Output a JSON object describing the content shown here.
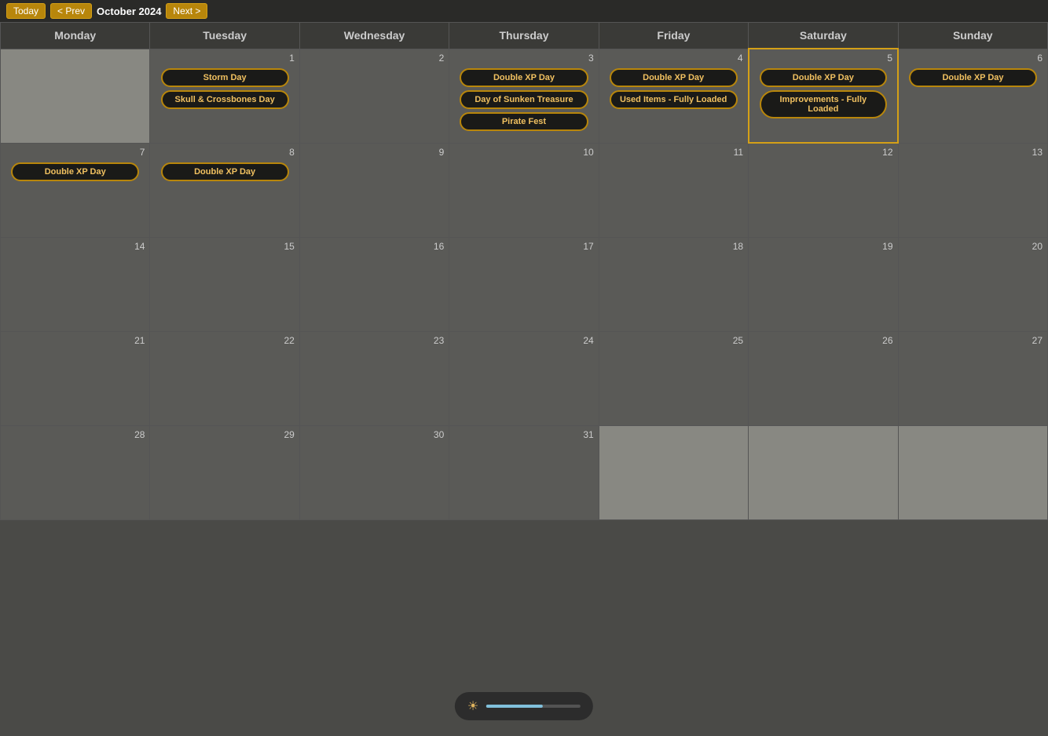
{
  "topbar": {
    "today_label": "Today",
    "prev_label": "< Prev",
    "month_label": "October 2024",
    "next_label": "Next >"
  },
  "headers": [
    "Monday",
    "Tuesday",
    "Wednesday",
    "Thursday",
    "Friday",
    "Saturday",
    "Sunday"
  ],
  "weeks": [
    {
      "days": [
        {
          "number": "",
          "events": [],
          "grayed": true
        },
        {
          "number": "1",
          "events": [
            "Storm Day",
            "Skull & Crossbones Day"
          ],
          "grayed": false
        },
        {
          "number": "2",
          "events": [],
          "grayed": false
        },
        {
          "number": "3",
          "events": [
            "Double XP Day",
            "Day of Sunken Treasure",
            "Pirate Fest"
          ],
          "grayed": false
        },
        {
          "number": "4",
          "events": [
            "Double XP Day",
            "Used Items - Fully Loaded"
          ],
          "grayed": false
        },
        {
          "number": "5",
          "events": [
            "Double XP Day",
            "Improvements - Fully Loaded"
          ],
          "today": true,
          "grayed": false
        },
        {
          "number": "6",
          "events": [
            "Double XP Day"
          ],
          "grayed": false
        }
      ]
    },
    {
      "days": [
        {
          "number": "7",
          "events": [
            "Double XP Day"
          ],
          "grayed": false
        },
        {
          "number": "8",
          "events": [
            "Double XP Day"
          ],
          "grayed": false
        },
        {
          "number": "9",
          "events": [],
          "grayed": false
        },
        {
          "number": "10",
          "events": [],
          "grayed": false
        },
        {
          "number": "11",
          "events": [],
          "grayed": false
        },
        {
          "number": "12",
          "events": [],
          "grayed": false
        },
        {
          "number": "13",
          "events": [],
          "grayed": false
        }
      ]
    },
    {
      "days": [
        {
          "number": "14",
          "events": [],
          "grayed": false
        },
        {
          "number": "15",
          "events": [],
          "grayed": false
        },
        {
          "number": "16",
          "events": [],
          "grayed": false
        },
        {
          "number": "17",
          "events": [],
          "grayed": false
        },
        {
          "number": "18",
          "events": [],
          "grayed": false
        },
        {
          "number": "19",
          "events": [],
          "grayed": false
        },
        {
          "number": "20",
          "events": [],
          "grayed": false
        }
      ]
    },
    {
      "days": [
        {
          "number": "21",
          "events": [],
          "grayed": false
        },
        {
          "number": "22",
          "events": [],
          "grayed": false
        },
        {
          "number": "23",
          "events": [],
          "grayed": false
        },
        {
          "number": "24",
          "events": [],
          "grayed": false
        },
        {
          "number": "25",
          "events": [],
          "grayed": false
        },
        {
          "number": "26",
          "events": [],
          "grayed": false
        },
        {
          "number": "27",
          "events": [],
          "grayed": false
        }
      ]
    },
    {
      "days": [
        {
          "number": "28",
          "events": [],
          "grayed": false
        },
        {
          "number": "29",
          "events": [],
          "grayed": false
        },
        {
          "number": "30",
          "events": [],
          "grayed": false
        },
        {
          "number": "31",
          "events": [],
          "grayed": false
        },
        {
          "number": "",
          "events": [],
          "grayed": true
        },
        {
          "number": "",
          "events": [],
          "grayed": true
        },
        {
          "number": "",
          "events": [],
          "grayed": true
        }
      ]
    }
  ]
}
